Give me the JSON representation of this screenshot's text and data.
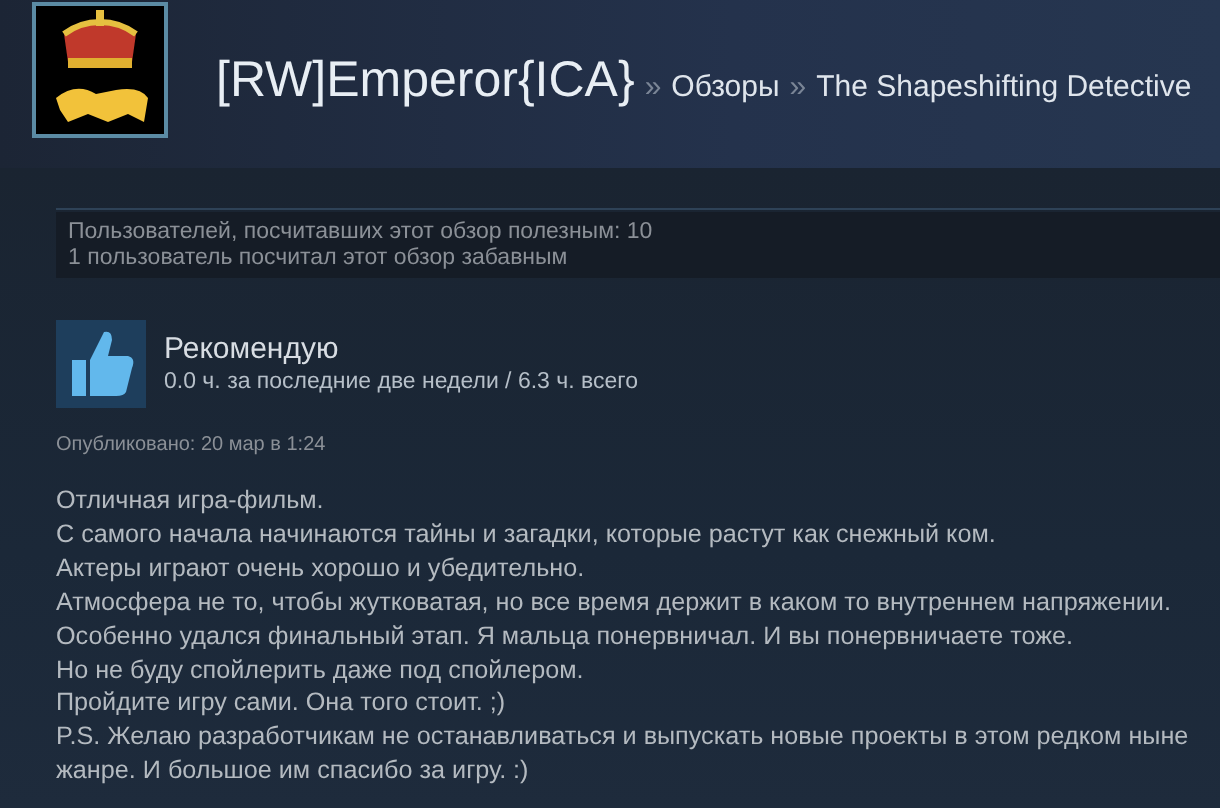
{
  "header": {
    "username": "[RW]Emperor{ICA}",
    "breadcrumbs": [
      {
        "separator": "»",
        "label": "Обзоры"
      },
      {
        "separator": "»",
        "label": "The Shapeshifting Detective"
      }
    ]
  },
  "ratings": [
    "Пользователей, посчитавших этот обзор полезным: 10",
    "1 пользователь посчитал этот обзор забавным"
  ],
  "review": {
    "verdict": "Рекомендую",
    "hours": "0.0 ч. за последние две недели / 6.3 ч. всего",
    "posted": "Опубликовано: 20 мар в 1:24",
    "paragraphs": [
      "Отличная игра-фильм.",
      "С самого начала начинаются тайны и загадки, которые растут как снежный ком.",
      "Актеры играют очень хорошо и убедительно.",
      "Атмосфера не то, чтобы жутковатая, но все время держит в каком то внутреннем напряжении.",
      "Особенно удался финальный этап. Я мальца понервничал. И вы понервничаете тоже.",
      "Но не буду спойлерить даже под спойлером.",
      "Пройдите игру сами. Она того стоит. ;)",
      "P.S. Желаю разработчикам не останавливаться и выпускать новые проекты в этом редком ныне жанре. И большое им спасибо за игру. :)"
    ]
  }
}
